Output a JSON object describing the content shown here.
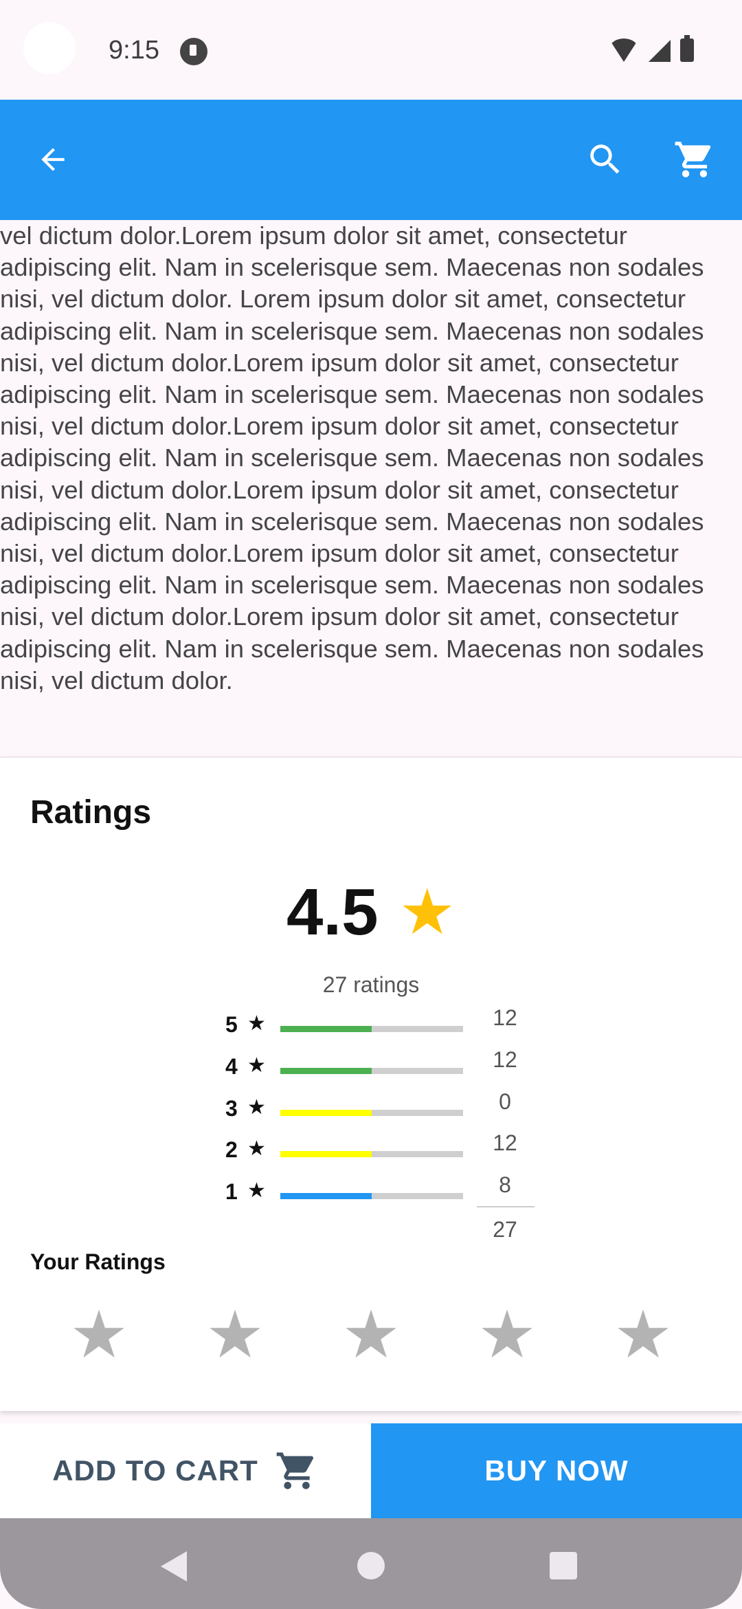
{
  "status_bar": {
    "time": "9:15"
  },
  "app_bar": {
    "back_icon": "arrow-back-icon",
    "search_icon": "search-icon",
    "cart_icon": "shopping-cart-icon",
    "color": "#2196f3"
  },
  "description": {
    "text": "vel dictum dolor.Lorem ipsum dolor sit amet, consectetur adipiscing elit. Nam in scelerisque sem. Maecenas non sodales nisi, vel dictum dolor. Lorem ipsum dolor sit amet, consectetur adipiscing elit. Nam in scelerisque sem. Maecenas non sodales nisi, vel dictum dolor.Lorem ipsum dolor sit amet, consectetur adipiscing elit. Nam in scelerisque sem. Maecenas non sodales nisi, vel dictum dolor.Lorem ipsum dolor sit amet, consectetur adipiscing elit. Nam in scelerisque sem. Maecenas non sodales nisi, vel dictum dolor.Lorem ipsum dolor sit amet, consectetur adipiscing elit. Nam in scelerisque sem. Maecenas non sodales nisi, vel dictum dolor.Lorem ipsum dolor sit amet, consectetur adipiscing elit. Nam in scelerisque sem. Maecenas non sodales nisi, vel dictum dolor.Lorem ipsum dolor sit amet, consectetur adipiscing elit. Nam in scelerisque sem. Maecenas non sodales nisi, vel dictum dolor."
  },
  "ratings": {
    "title": "Ratings",
    "average": "4.5",
    "average_star": "★",
    "count_label": "27 ratings",
    "rows": [
      {
        "label": "5",
        "star": "★",
        "count": "12",
        "fill": 0.5,
        "color": "#4caf50"
      },
      {
        "label": "4",
        "star": "★",
        "count": "12",
        "fill": 0.5,
        "color": "#4caf50"
      },
      {
        "label": "3",
        "star": "★",
        "count": "0",
        "fill": 0.5,
        "color": "#ffff00"
      },
      {
        "label": "2",
        "star": "★",
        "count": "12",
        "fill": 0.5,
        "color": "#ffff00"
      },
      {
        "label": "1",
        "star": "★",
        "count": "8",
        "fill": 0.5,
        "color": "#2196f3"
      }
    ],
    "total": "27",
    "your_ratings_label": "Your Ratings",
    "your_rating_stars": [
      "★",
      "★",
      "★",
      "★",
      "★"
    ],
    "your_rating_value": 0
  },
  "actions": {
    "add_to_cart_label": "ADD TO CART",
    "add_to_cart_icon": "shopping-cart-icon",
    "buy_now_label": "BUY NOW"
  }
}
